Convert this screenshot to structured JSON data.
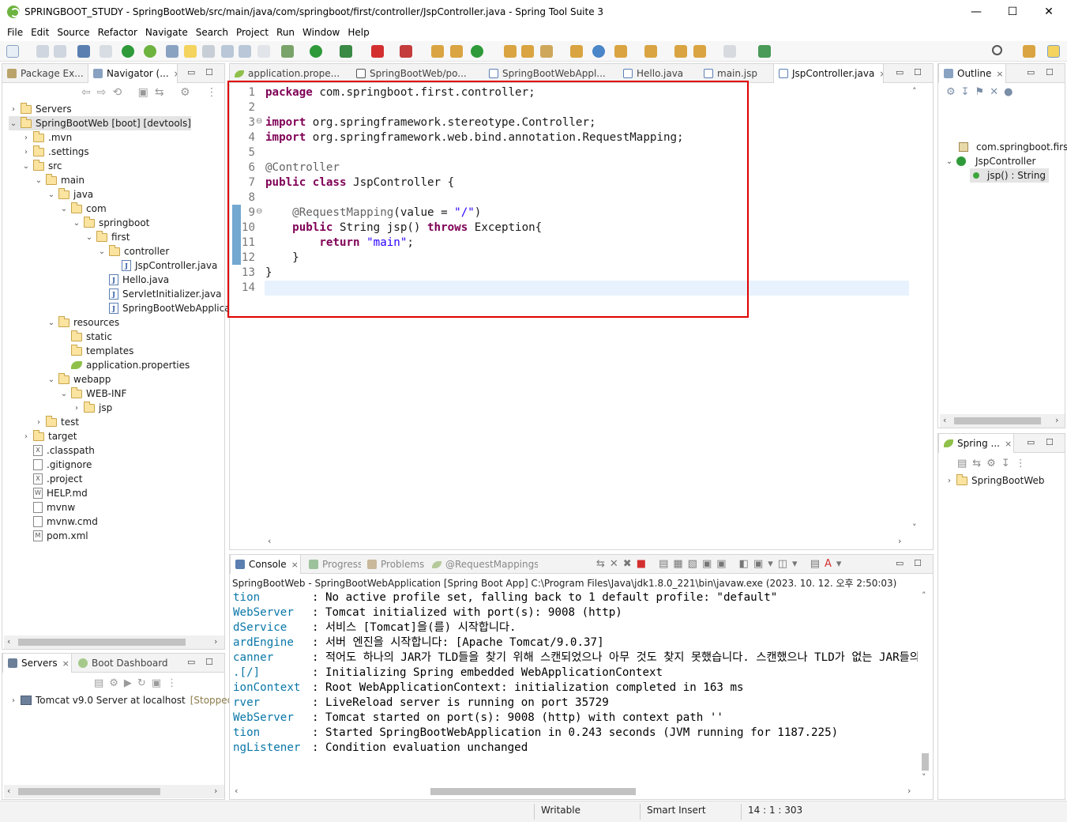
{
  "window": {
    "title": "SPRINGBOOT_STUDY - SpringBootWeb/src/main/java/com/springboot/first/controller/JspController.java - Spring Tool Suite 3",
    "minimize": "—",
    "maximize": "☐",
    "close": "✕"
  },
  "menu": [
    "File",
    "Edit",
    "Source",
    "Refactor",
    "Navigate",
    "Search",
    "Project",
    "Run",
    "Window",
    "Help"
  ],
  "left_view": {
    "tabs": [
      "Package Ex...",
      "Navigator (...",
      "×"
    ],
    "tree": [
      {
        "label": "Servers",
        "kind": "folder",
        "twisty": "›"
      },
      {
        "label": "SpringBootWeb [boot] [devtools]",
        "kind": "project",
        "twisty": "⌄"
      },
      {
        "label": ".mvn",
        "kind": "folder",
        "twisty": "›"
      },
      {
        "label": ".settings",
        "kind": "folder",
        "twisty": "›"
      },
      {
        "label": "src",
        "kind": "folder",
        "twisty": "⌄"
      },
      {
        "label": "main",
        "kind": "folder",
        "twisty": "⌄"
      },
      {
        "label": "java",
        "kind": "folder",
        "twisty": "⌄"
      },
      {
        "label": "com",
        "kind": "folder",
        "twisty": "⌄"
      },
      {
        "label": "springboot",
        "kind": "folder",
        "twisty": "⌄"
      },
      {
        "label": "first",
        "kind": "folder",
        "twisty": "⌄"
      },
      {
        "label": "controller",
        "kind": "folder",
        "twisty": "⌄"
      },
      {
        "label": "JspController.java",
        "kind": "java",
        "twisty": ""
      },
      {
        "label": "Hello.java",
        "kind": "java",
        "twisty": ""
      },
      {
        "label": "ServletInitializer.java",
        "kind": "java",
        "twisty": ""
      },
      {
        "label": "SpringBootWebApplicat",
        "kind": "java",
        "twisty": ""
      },
      {
        "label": "resources",
        "kind": "folder",
        "twisty": "⌄"
      },
      {
        "label": "static",
        "kind": "folder",
        "twisty": ""
      },
      {
        "label": "templates",
        "kind": "folder",
        "twisty": ""
      },
      {
        "label": "application.properties",
        "kind": "leaf",
        "twisty": ""
      },
      {
        "label": "webapp",
        "kind": "folder",
        "twisty": "⌄"
      },
      {
        "label": "WEB-INF",
        "kind": "folder",
        "twisty": "⌄"
      },
      {
        "label": "jsp",
        "kind": "folder",
        "twisty": "›"
      },
      {
        "label": "test",
        "kind": "folder",
        "twisty": "›"
      },
      {
        "label": "target",
        "kind": "folder",
        "twisty": "›"
      },
      {
        "label": ".classpath",
        "kind": "xfile",
        "twisty": ""
      },
      {
        "label": ".gitignore",
        "kind": "file",
        "twisty": ""
      },
      {
        "label": ".project",
        "kind": "xfile",
        "twisty": ""
      },
      {
        "label": "HELP.md",
        "kind": "wfile",
        "twisty": ""
      },
      {
        "label": "mvnw",
        "kind": "file",
        "twisty": ""
      },
      {
        "label": "mvnw.cmd",
        "kind": "file",
        "twisty": ""
      },
      {
        "label": "pom.xml",
        "kind": "mfile",
        "twisty": ""
      }
    ]
  },
  "servers_view": {
    "tabs": [
      "Servers",
      "×",
      "Boot Dashboard"
    ],
    "item": "Tomcat v9.0 Server at localhost",
    "item_state": "[Stopped, R"
  },
  "editor": {
    "tabs": [
      "application.prope...",
      "SpringBootWeb/po...",
      "SpringBootWebAppl...",
      "Hello.java",
      "main.jsp",
      "JspController.java",
      "×"
    ],
    "lines": [
      {
        "n": "1",
        "parts": [
          [
            "kw",
            "package"
          ],
          [
            "",
            " com.springboot.first.controller;"
          ]
        ]
      },
      {
        "n": "2",
        "parts": []
      },
      {
        "n": "3",
        "fold": "⊖",
        "parts": [
          [
            "kw",
            "import"
          ],
          [
            "",
            " org.springframework.stereotype.Controller;"
          ]
        ]
      },
      {
        "n": "4",
        "parts": [
          [
            "kw",
            "import"
          ],
          [
            "",
            " org.springframework.web.bind.annotation.RequestMapping;"
          ]
        ]
      },
      {
        "n": "5",
        "parts": []
      },
      {
        "n": "6",
        "parts": [
          [
            "ann",
            "@Controller"
          ]
        ]
      },
      {
        "n": "7",
        "parts": [
          [
            "kw",
            "public"
          ],
          [
            "",
            " "
          ],
          [
            "kw",
            "class"
          ],
          [
            "",
            " JspController {"
          ]
        ]
      },
      {
        "n": "8",
        "parts": []
      },
      {
        "n": "9",
        "fold": "⊖",
        "parts": [
          [
            "",
            "    "
          ],
          [
            "ann",
            "@RequestMapping"
          ],
          [
            "",
            "(value = "
          ],
          [
            "str",
            "\"/\""
          ],
          [
            "",
            ")"
          ]
        ]
      },
      {
        "n": "10",
        "parts": [
          [
            "",
            "    "
          ],
          [
            "kw",
            "public"
          ],
          [
            "",
            " String jsp() "
          ],
          [
            "kw",
            "throws"
          ],
          [
            "",
            " Exception{"
          ]
        ]
      },
      {
        "n": "11",
        "parts": [
          [
            "",
            "        "
          ],
          [
            "kw",
            "return"
          ],
          [
            "",
            " "
          ],
          [
            "str",
            "\"main\""
          ],
          [
            "",
            ";"
          ]
        ]
      },
      {
        "n": "12",
        "parts": [
          [
            "",
            "    }"
          ]
        ]
      },
      {
        "n": "13",
        "parts": [
          [
            "",
            "}"
          ]
        ]
      },
      {
        "n": "14",
        "parts": []
      }
    ]
  },
  "outline": {
    "tabs": [
      "Outline",
      "×"
    ],
    "items": [
      "com.springboot.first",
      "JspController",
      "jsp() : String"
    ]
  },
  "spring_view": {
    "tabs": [
      "Spring ...",
      "×"
    ],
    "item": "SpringBootWeb"
  },
  "console": {
    "tabs": [
      "Console",
      "×",
      "Progress",
      "Problems",
      "@RequestMappings"
    ],
    "header": "SpringBootWeb - SpringBootWebApplication [Spring Boot App] C:\\Program Files\\Java\\jdk1.8.0_221\\bin\\javaw.exe  (2023. 10. 12. 오후 2:50:03)",
    "lines": [
      {
        "src": "tion",
        "msg": "No active profile set, falling back to 1 default profile: \"default\""
      },
      {
        "src": "WebServer",
        "msg": "Tomcat initialized with port(s): 9008 (http)"
      },
      {
        "src": "dService",
        "msg": "서비스 [Tomcat]을(를) 시작합니다."
      },
      {
        "src": "ardEngine",
        "msg": "서버 엔진을 시작합니다: [Apache Tomcat/9.0.37]"
      },
      {
        "src": "canner",
        "msg": "적어도 하나의 JAR가 TLD들을 찾기 위해 스캔되었으나 아무 것도 찾지 못했습니다. 스캔했으나 TLD가 없는 JAR들의 전체 목록을 보시"
      },
      {
        "src": ".[/]",
        "msg": "Initializing Spring embedded WebApplicationContext"
      },
      {
        "src": "ionContext",
        "msg": "Root WebApplicationContext: initialization completed in 163 ms"
      },
      {
        "src": "rver",
        "msg": "LiveReload server is running on port 35729"
      },
      {
        "src": "WebServer",
        "msg": "Tomcat started on port(s): 9008 (http) with context path ''"
      },
      {
        "src": "tion",
        "msg": "Started SpringBootWebApplication in 0.243 seconds (JVM running for 1187.225)"
      },
      {
        "src": "ngListener",
        "msg": "Condition evaluation unchanged"
      }
    ]
  },
  "status": {
    "writable": "Writable",
    "insert_mode": "Smart Insert",
    "position": "14 : 1 : 303"
  },
  "highlight_color": "#e00000"
}
